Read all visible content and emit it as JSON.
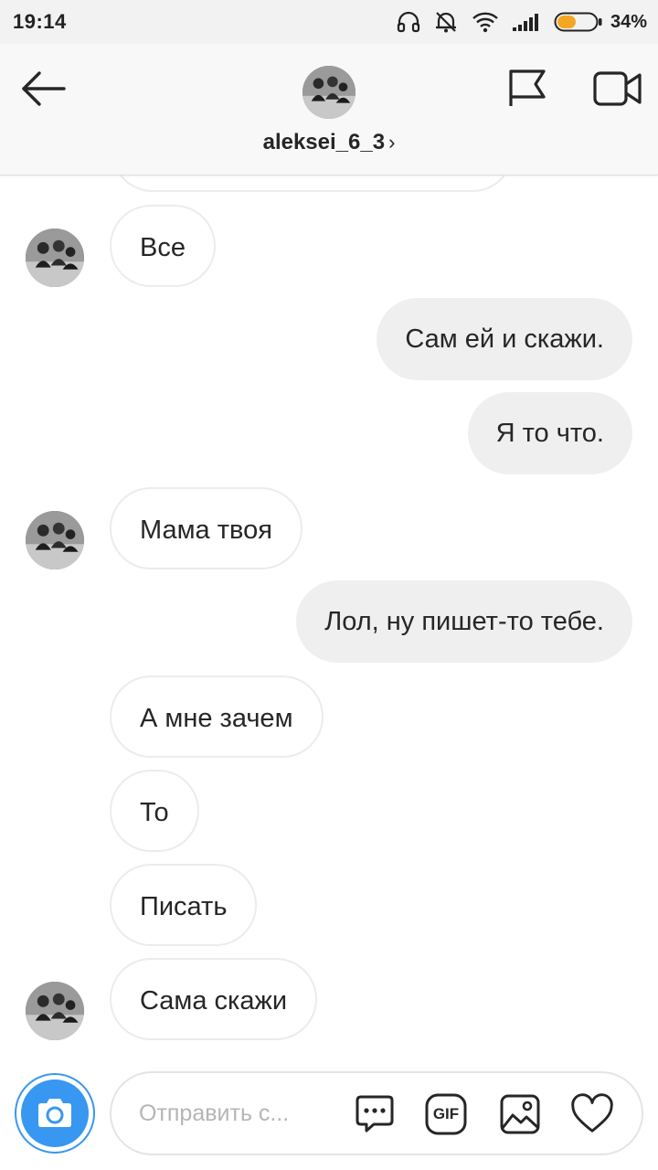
{
  "status_bar": {
    "time": "19:14",
    "battery_percent": "34%",
    "battery_level": 0.34,
    "icons": [
      "headphones-icon",
      "muted-bell-icon",
      "wifi-icon",
      "signal-icon",
      "battery-icon"
    ]
  },
  "header": {
    "username": "aleksei_6_3",
    "chevron": "›",
    "icons": [
      "back-arrow-icon",
      "flag-icon",
      "video-call-icon"
    ]
  },
  "messages": [
    {
      "direction": "incoming",
      "text": "Все",
      "show_avatar": true
    },
    {
      "direction": "outgoing",
      "text": "Сам ей и скажи."
    },
    {
      "direction": "outgoing",
      "text": "Я то что."
    },
    {
      "direction": "incoming",
      "text": "Мама твоя",
      "show_avatar": true
    },
    {
      "direction": "outgoing",
      "text": "Лол, ну пишет-то тебе."
    },
    {
      "direction": "incoming",
      "text": "А мне зачем",
      "show_avatar": false
    },
    {
      "direction": "incoming",
      "text": "То",
      "show_avatar": false
    },
    {
      "direction": "incoming",
      "text": "Писать",
      "show_avatar": false
    },
    {
      "direction": "incoming",
      "text": "Сама скажи",
      "show_avatar": true
    }
  ],
  "composer": {
    "placeholder": "Отправить с...",
    "gif_label": "GIF",
    "icons": [
      "camera-icon",
      "chat-bubble-icon",
      "gif-icon",
      "gallery-icon",
      "heart-icon"
    ]
  },
  "colors": {
    "accent_blue": "#3897f0",
    "battery_orange": "#f5a623",
    "outgoing_bubble": "#efefef",
    "incoming_border": "#ececec"
  }
}
